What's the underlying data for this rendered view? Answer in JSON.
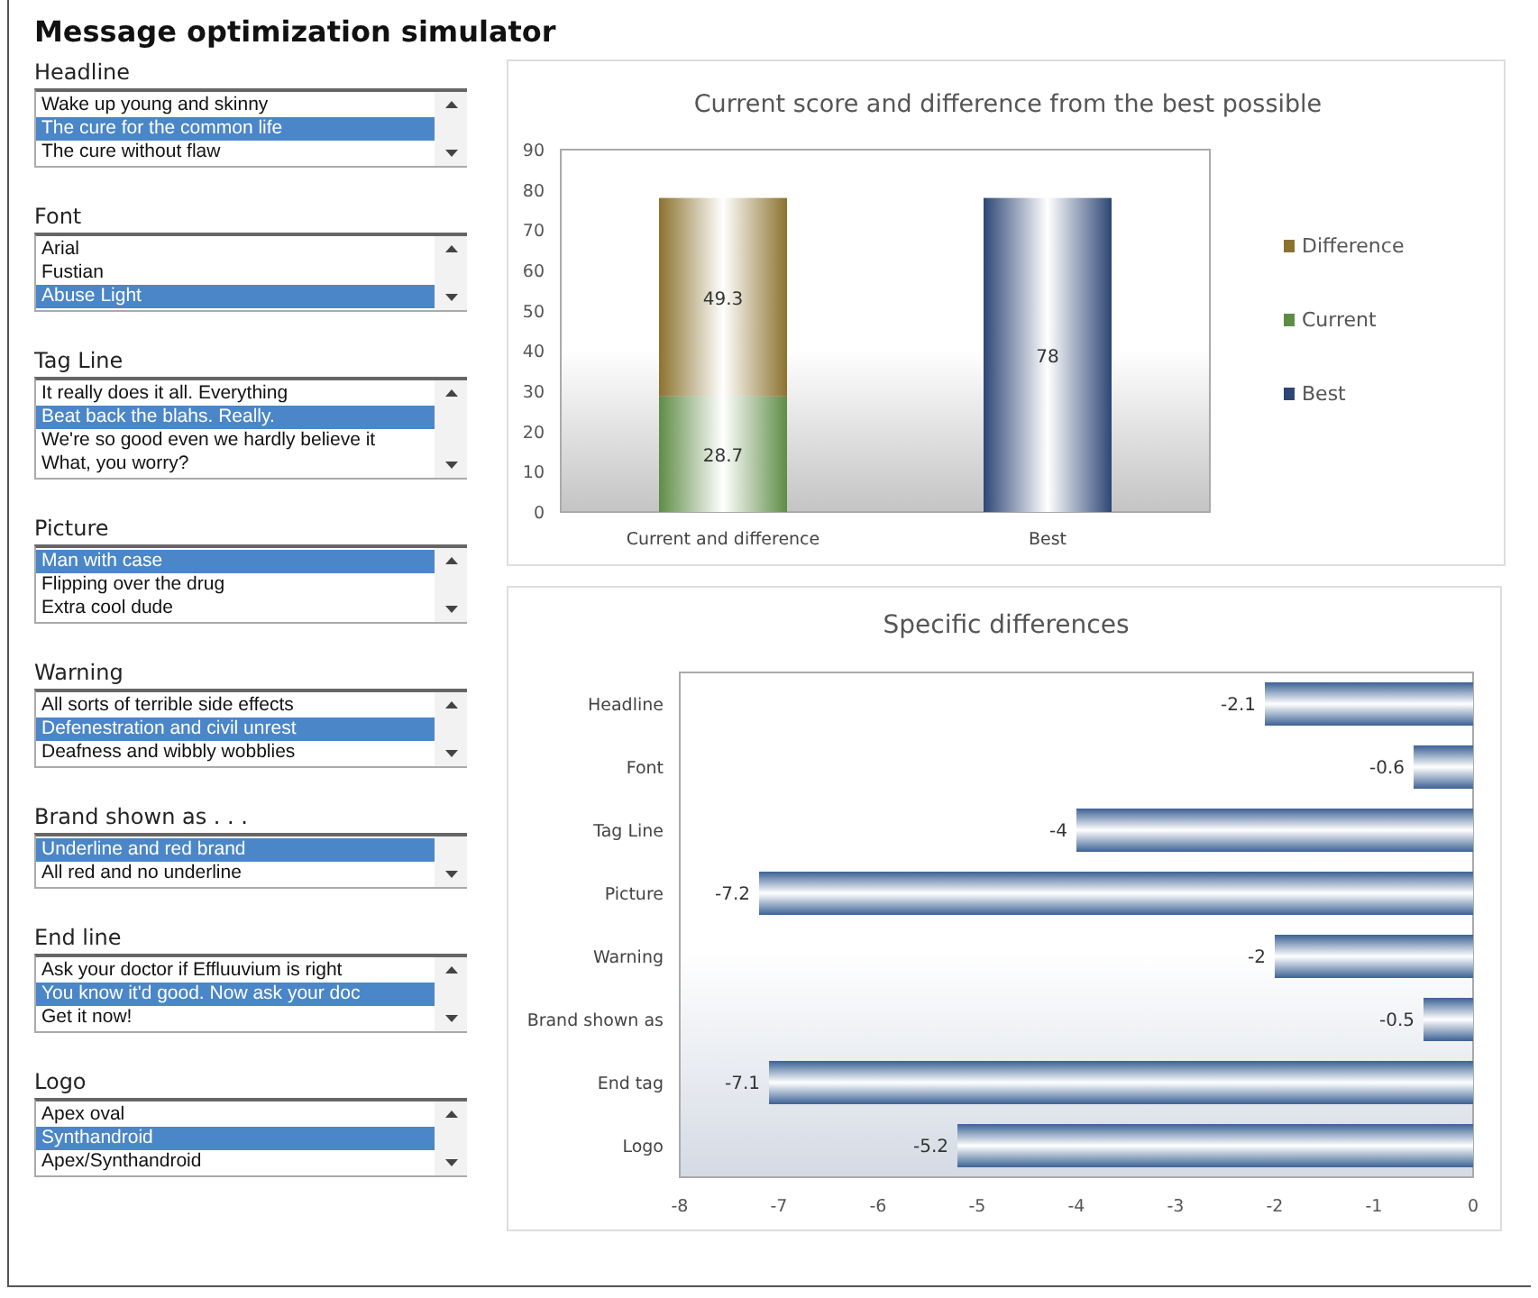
{
  "title": "Message optimization simulator",
  "lists": [
    {
      "label": "Headline",
      "items": [
        {
          "text": "Wake up young and skinny",
          "selected": false
        },
        {
          "text": "The cure for the common life",
          "selected": true
        },
        {
          "text": "The cure without flaw",
          "selected": false
        }
      ]
    },
    {
      "label": "Font",
      "items": [
        {
          "text": "Arial",
          "selected": false
        },
        {
          "text": "Fustian",
          "selected": false
        },
        {
          "text": "Abuse Light",
          "selected": true
        }
      ]
    },
    {
      "label": "Tag Line",
      "items": [
        {
          "text": "It really does it all. Everything",
          "selected": false
        },
        {
          "text": "Beat back the blahs. Really.",
          "selected": true
        },
        {
          "text": "We're so good even we hardly believe it",
          "selected": false
        },
        {
          "text": "What, you worry?",
          "selected": false
        }
      ]
    },
    {
      "label": "Picture",
      "items": [
        {
          "text": "Man with case",
          "selected": true
        },
        {
          "text": "Flipping over the drug",
          "selected": false
        },
        {
          "text": "Extra cool dude",
          "selected": false
        }
      ]
    },
    {
      "label": "Warning",
      "items": [
        {
          "text": "All sorts of terrible side effects",
          "selected": false
        },
        {
          "text": "Defenestration and civil unrest",
          "selected": true
        },
        {
          "text": "Deafness and wibbly wobblies",
          "selected": false
        }
      ]
    },
    {
      "label": "Brand shown as . . .",
      "items": [
        {
          "text": "Underline and red brand",
          "selected": true
        },
        {
          "text": "All red and no underline",
          "selected": false
        }
      ]
    },
    {
      "label": "End line",
      "items": [
        {
          "text": "Ask your doctor if Effluuvium is right",
          "selected": false
        },
        {
          "text": "You know it'd good. Now ask your doc",
          "selected": true
        },
        {
          "text": "Get it now!",
          "selected": false
        }
      ]
    },
    {
      "label": "Logo",
      "items": [
        {
          "text": "Apex oval",
          "selected": false
        },
        {
          "text": "Synthandroid",
          "selected": true
        },
        {
          "text": "Apex/Synthandroid",
          "selected": false
        }
      ]
    }
  ],
  "score_chart": {
    "chart_data": {
      "type": "bar",
      "title": "Current score and difference from the best possible",
      "categories": [
        "Current and difference",
        "Best"
      ],
      "stacked": true,
      "ylim": [
        0,
        90
      ],
      "yticks": [
        0,
        10,
        20,
        30,
        40,
        50,
        60,
        70,
        80,
        90
      ],
      "data_labels": true,
      "legend": "right",
      "series": [
        {
          "name": "Difference",
          "color": "#8c722e",
          "values": [
            49.3,
            null
          ]
        },
        {
          "name": "Current",
          "color": "#5e8c46",
          "values": [
            28.7,
            null
          ]
        },
        {
          "name": "Best",
          "color": "#2e4676",
          "values": [
            null,
            78
          ]
        }
      ]
    }
  },
  "diff_chart": {
    "chart_data": {
      "type": "bar",
      "orientation": "horizontal",
      "title": "Specific differences",
      "categories": [
        "Headline",
        "Font",
        "Tag Line",
        "Picture",
        "Warning",
        "Brand shown as",
        "End tag",
        "Logo"
      ],
      "xlim": [
        -8,
        0
      ],
      "xticks": [
        -8,
        -7,
        -6,
        -5,
        -4,
        -3,
        -2,
        -1,
        0
      ],
      "data_labels": true,
      "series": [
        {
          "color": "#3c6294",
          "values": [
            -2.1,
            -0.6,
            -4,
            -7.2,
            -2,
            -0.5,
            -7.1,
            -5.2
          ]
        }
      ]
    }
  }
}
